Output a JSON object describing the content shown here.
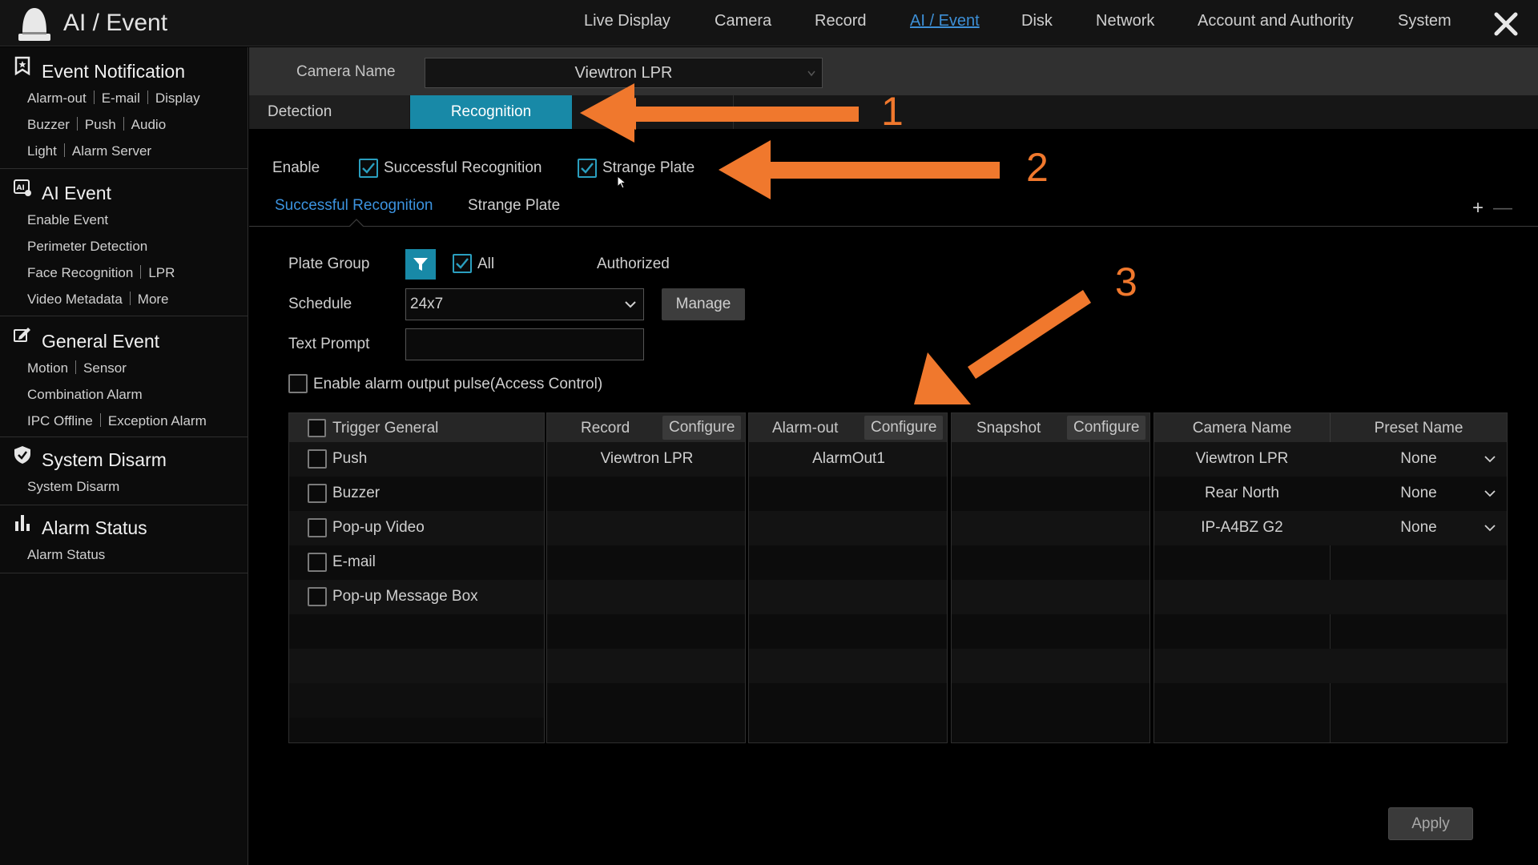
{
  "app": {
    "title": "AI / Event"
  },
  "nav": [
    {
      "label": "Live Display",
      "active": false
    },
    {
      "label": "Camera",
      "active": false
    },
    {
      "label": "Record",
      "active": false
    },
    {
      "label": "AI / Event",
      "active": true
    },
    {
      "label": "Disk",
      "active": false
    },
    {
      "label": "Network",
      "active": false
    },
    {
      "label": "Account and Authority",
      "active": false
    },
    {
      "label": "System",
      "active": false
    }
  ],
  "sidebar": {
    "event_notification": {
      "title": "Event Notification",
      "links": [
        "Alarm-out",
        "E-mail",
        "Display",
        "Buzzer",
        "Push",
        "Audio",
        "Light",
        "Alarm Server"
      ]
    },
    "ai_event": {
      "title": "AI Event",
      "links": [
        "Enable Event",
        "Perimeter Detection",
        "Face Recognition",
        "LPR",
        "Video Metadata",
        "More"
      ]
    },
    "general_event": {
      "title": "General Event",
      "links": [
        "Motion",
        "Sensor",
        "Combination Alarm",
        "IPC Offline",
        "Exception Alarm"
      ]
    },
    "system_disarm": {
      "title": "System Disarm",
      "links": [
        "System Disarm"
      ]
    },
    "alarm_status": {
      "title": "Alarm Status",
      "links": [
        "Alarm Status"
      ]
    }
  },
  "camera": {
    "label": "Camera Name",
    "value": "Viewtron LPR"
  },
  "tabs": [
    {
      "label": "Detection"
    },
    {
      "label": "Recognition",
      "active": true
    }
  ],
  "enable": {
    "label": "Enable",
    "successful": {
      "label": "Successful Recognition",
      "checked": true
    },
    "strange": {
      "label": "Strange Plate",
      "checked": true
    }
  },
  "subtabs": [
    {
      "label": "Successful Recognition",
      "active": true
    },
    {
      "label": "Strange Plate"
    }
  ],
  "controls": {
    "plus": "+",
    "minus": "—"
  },
  "form": {
    "plate_group_label": "Plate Group",
    "all_label": "All",
    "all_checked": true,
    "authorized_label": "Authorized",
    "schedule_label": "Schedule",
    "schedule_value": "24x7",
    "manage_label": "Manage",
    "text_prompt_label": "Text Prompt",
    "text_prompt_value": "",
    "pulse_label": "Enable alarm output pulse(Access Control)",
    "pulse_checked": false
  },
  "table": {
    "trigger_header": "Trigger General",
    "record_header": "Record",
    "alarmout_header": "Alarm-out",
    "snapshot_header": "Snapshot",
    "configure_label": "Configure",
    "camera_header": "Camera Name",
    "preset_header": "Preset Name",
    "triggers": [
      "Push",
      "Buzzer",
      "Pop-up Video",
      "E-mail",
      "Pop-up Message Box"
    ],
    "record_value": "Viewtron LPR",
    "alarmout_value": "AlarmOut1",
    "preset_rows": [
      {
        "camera": "Viewtron LPR",
        "preset": "None"
      },
      {
        "camera": "Rear North",
        "preset": "None"
      },
      {
        "camera": "IP-A4BZ G2",
        "preset": "None"
      }
    ]
  },
  "apply_label": "Apply",
  "annotations": [
    "1",
    "2",
    "3"
  ],
  "colors": {
    "accent": "#1889a7",
    "link": "#3c93df",
    "annotation": "#f0782d"
  }
}
